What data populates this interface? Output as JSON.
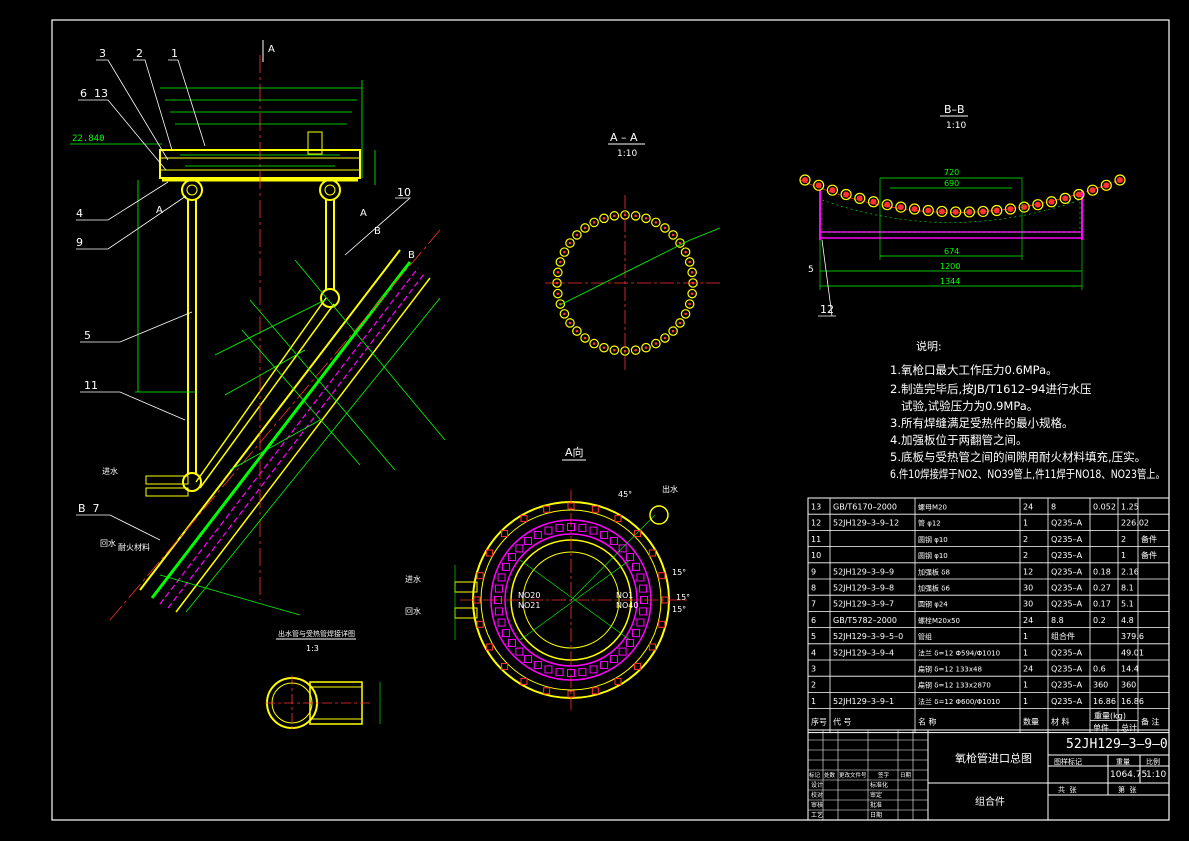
{
  "front_view": {
    "balloons": [
      "1",
      "2",
      "3",
      "6  13",
      "4",
      "9",
      "10",
      "5",
      "11",
      "B  7"
    ],
    "elevation": "22.840",
    "section_mark": "A",
    "section_mark_b": "B",
    "water_in": "进水",
    "water_out": "回水",
    "label_outlet": "出水",
    "label_fire": "耐火材料"
  },
  "section_aa": {
    "title": "A – A",
    "scale": "1:10"
  },
  "section_bb": {
    "title": "B–B",
    "scale": "1:10",
    "dims": [
      "720",
      "690",
      "674",
      "1200",
      "1344"
    ],
    "balloon": "12",
    "side_marks": [
      "5"
    ]
  },
  "view_a": {
    "title": "A向",
    "labels": [
      "NO20",
      "NO21",
      "NO1",
      "NO40",
      "进水",
      "回水",
      "出水"
    ],
    "angles": [
      "45°",
      "15°",
      "15°",
      "15°"
    ]
  },
  "detail": {
    "title": "出水管与受热管焊接详图",
    "scale": "1:3"
  },
  "notes": {
    "heading": "说明:",
    "items": [
      "1.氧枪口最大工作压力0.6MPa。",
      "2.制造完毕后,按JB/T1612–94进行水压",
      "   试验,试验压力为0.9MPa。",
      "3.所有焊缝满足受热件的最小规格。",
      "4.加强板位于两翻管之间。",
      "5.底板与受热管之间的间隙用耐火材料填充,压实。",
      "6.件10焊接焊于NO2、NO39管上,件11焊于NO18、NO23管上。"
    ]
  },
  "bom": {
    "header": [
      "序号",
      "代  号",
      "名  称",
      "数量",
      "材  料",
      "单件",
      "总计",
      "备  注"
    ],
    "weight_header": "重量(kg)",
    "rows": [
      [
        "13",
        "GB/T6170–2000",
        "螺母M20",
        "24",
        "8",
        "0.052",
        "1.25",
        ""
      ],
      [
        "12",
        "52JH129–3–9–12",
        "管 φ12",
        "1",
        "Q235–A",
        "",
        "226.02",
        ""
      ],
      [
        "11",
        "",
        "圆钢 φ10",
        "2",
        "Q235–A",
        "",
        "2",
        "备件"
      ],
      [
        "10",
        "",
        "圆钢 φ10",
        "2",
        "Q235–A",
        "",
        "1",
        "备件"
      ],
      [
        "9",
        "52JH129–3–9–9",
        "加强板 δ8",
        "12",
        "Q235–A",
        "0.18",
        "2.16",
        ""
      ],
      [
        "8",
        "52JH129–3–9–8",
        "加强板 δ6",
        "30",
        "Q235–A",
        "0.27",
        "8.1",
        ""
      ],
      [
        "7",
        "52JH129–3–9–7",
        "圆钢 φ24",
        "30",
        "Q235–A",
        "0.17",
        "5.1",
        ""
      ],
      [
        "6",
        "GB/T5782–2000",
        "螺栓M20x50",
        "24",
        "8.8",
        "0.2",
        "4.8",
        ""
      ],
      [
        "5",
        "52JH129–3–9–5–0",
        "管组",
        "1",
        "组合件",
        "",
        "379.6",
        ""
      ],
      [
        "4",
        "52JH129–3–9–4",
        "法兰 δ=12  Φ594/Φ1010",
        "1",
        "Q235–A",
        "",
        "49.01",
        ""
      ],
      [
        "3",
        "",
        "扁钢 δ=12  133x48",
        "24",
        "Q235–A",
        "0.6",
        "14.4",
        ""
      ],
      [
        "2",
        "",
        "扁钢 δ=12 133x2870",
        "1",
        "Q235–A",
        "360",
        "360",
        ""
      ],
      [
        "1",
        "52JH129–3–9–1",
        "法兰 δ=12  Φ600/Φ1010",
        "1",
        "Q235–A",
        "16.86",
        "16.86",
        ""
      ]
    ]
  },
  "title_block": {
    "drawing_no": "52JH129–3–9–0",
    "name": "氧枪管进口总图",
    "subname": "组合件",
    "weight": "1064.75",
    "scale": "1:10",
    "col_labels": [
      "图样标记",
      "重量",
      "比例"
    ],
    "sheet": [
      "共  张",
      "第  张"
    ],
    "sign_rows": [
      "标记",
      "处数",
      "更改文件号",
      "签字",
      "日期"
    ],
    "sign_roles": [
      "设计",
      "校对",
      "审核",
      "工艺",
      "标准化",
      "审定",
      "批准",
      "日期"
    ]
  },
  "colors": {
    "border": "#ffffff",
    "outline": "#ffff00",
    "center": "#ff3030",
    "dim": "#00ff00",
    "hidden": "#ff00ff",
    "cyan": "#00ffff"
  }
}
